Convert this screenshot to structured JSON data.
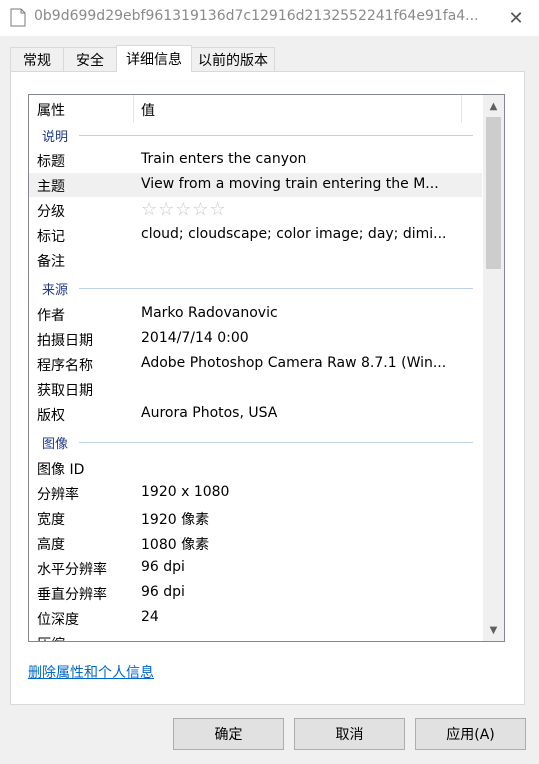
{
  "window": {
    "title": "0b9d699d29ebf961319136d7c12916d2132552241f64e91fa4...",
    "close_glyph": "✕"
  },
  "tabs": [
    "常规",
    "安全",
    "详细信息",
    "以前的版本"
  ],
  "columns": {
    "property": "属性",
    "value": "值"
  },
  "groups": {
    "description": "说明",
    "origin": "来源",
    "image": "图像"
  },
  "rows": {
    "title": {
      "key": "标题",
      "value": "Train enters the canyon"
    },
    "subject": {
      "key": "主题",
      "value": "View from a moving train entering the M..."
    },
    "rating": {
      "key": "分级",
      "stars": "☆☆☆☆☆",
      "value": 0
    },
    "tags": {
      "key": "标记",
      "value": "cloud; cloudscape; color image; day; dimi..."
    },
    "comments": {
      "key": "备注",
      "value": ""
    },
    "authors": {
      "key": "作者",
      "value": "Marko Radovanovic"
    },
    "date_taken": {
      "key": "拍摄日期",
      "value": "2014/7/14 0:00"
    },
    "program_name": {
      "key": "程序名称",
      "value": "Adobe Photoshop Camera Raw 8.7.1 (Win..."
    },
    "date_acquired": {
      "key": "获取日期",
      "value": ""
    },
    "copyright": {
      "key": "版权",
      "value": "Aurora Photos, USA"
    },
    "image_id": {
      "key": "图像 ID",
      "value": ""
    },
    "dimensions": {
      "key": "分辨率",
      "value": "1920 x 1080"
    },
    "width": {
      "key": "宽度",
      "value": "1920 像素"
    },
    "height": {
      "key": "高度",
      "value": "1080 像素"
    },
    "h_resolution": {
      "key": "水平分辨率",
      "value": "96 dpi"
    },
    "v_resolution": {
      "key": "垂直分辨率",
      "value": "96 dpi"
    },
    "bit_depth": {
      "key": "位深度",
      "value": "24"
    },
    "compression": {
      "key": "压缩",
      "value": ""
    }
  },
  "remove_link": "删除属性和个人信息",
  "buttons": {
    "ok": "确定",
    "cancel": "取消",
    "apply": "应用(A)"
  },
  "colors": {
    "link": "#0066cc",
    "group_header": "#1e3a8a"
  }
}
